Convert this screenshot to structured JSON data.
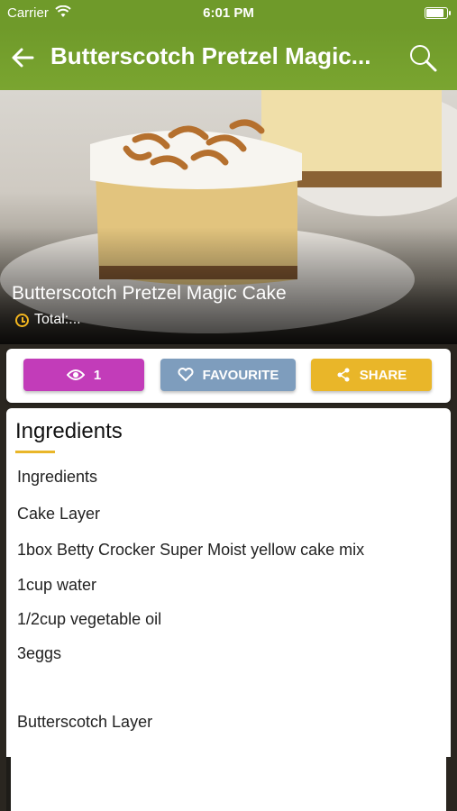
{
  "status_bar": {
    "carrier": "Carrier",
    "time": "6:01 PM"
  },
  "nav": {
    "title": "Butterscotch Pretzel Magic...",
    "back_icon": "arrow-left-icon",
    "search_icon": "search-icon"
  },
  "hero": {
    "title": "Butterscotch Pretzel Magic Cake",
    "total": "Total:..."
  },
  "actions": {
    "views_count": "1",
    "favourite_label": "FAVOURITE",
    "share_label": "SHARE"
  },
  "colors": {
    "nav": "#7aa530",
    "views": "#c23cb9",
    "favourite": "#7e9dbd",
    "share": "#e9b629"
  },
  "ingredients": {
    "heading": "Ingredients",
    "lines": [
      "Ingredients",
      "Cake Layer",
      "1box Betty Crocker Super Moist yellow cake mix",
      "1cup water",
      "1/2cup vegetable oil",
      "3eggs",
      "",
      "Butterscotch Layer"
    ]
  }
}
